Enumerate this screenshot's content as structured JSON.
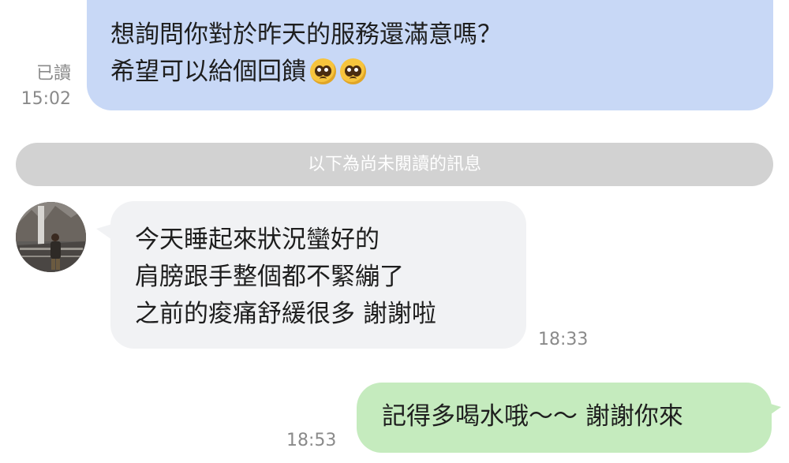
{
  "messages": {
    "out1": {
      "lines": [
        "想詢問你對於昨天的服務還滿意嗎？",
        "希望可以給個回饋"
      ],
      "emoji": "pleading-face-emoji",
      "read_status": "已讀",
      "time": "15:02"
    },
    "divider_text": "以下為尚未閱讀的訊息",
    "in1": {
      "lines": [
        "今天睡起來狀況蠻好的",
        "肩膀跟手整個都不緊繃了",
        "之前的痠痛舒緩很多 謝謝啦"
      ],
      "time": "18:33"
    },
    "out2": {
      "text": "記得多喝水哦～～ 謝謝你來",
      "time": "18:53"
    }
  },
  "colors": {
    "outgoing_bubble": "#c8d8f6",
    "incoming_bubble": "#f1f2f4",
    "outgoing_green": "#c5ebbe",
    "divider": "#d2d2d2",
    "meta_text": "#8a8a8a"
  }
}
